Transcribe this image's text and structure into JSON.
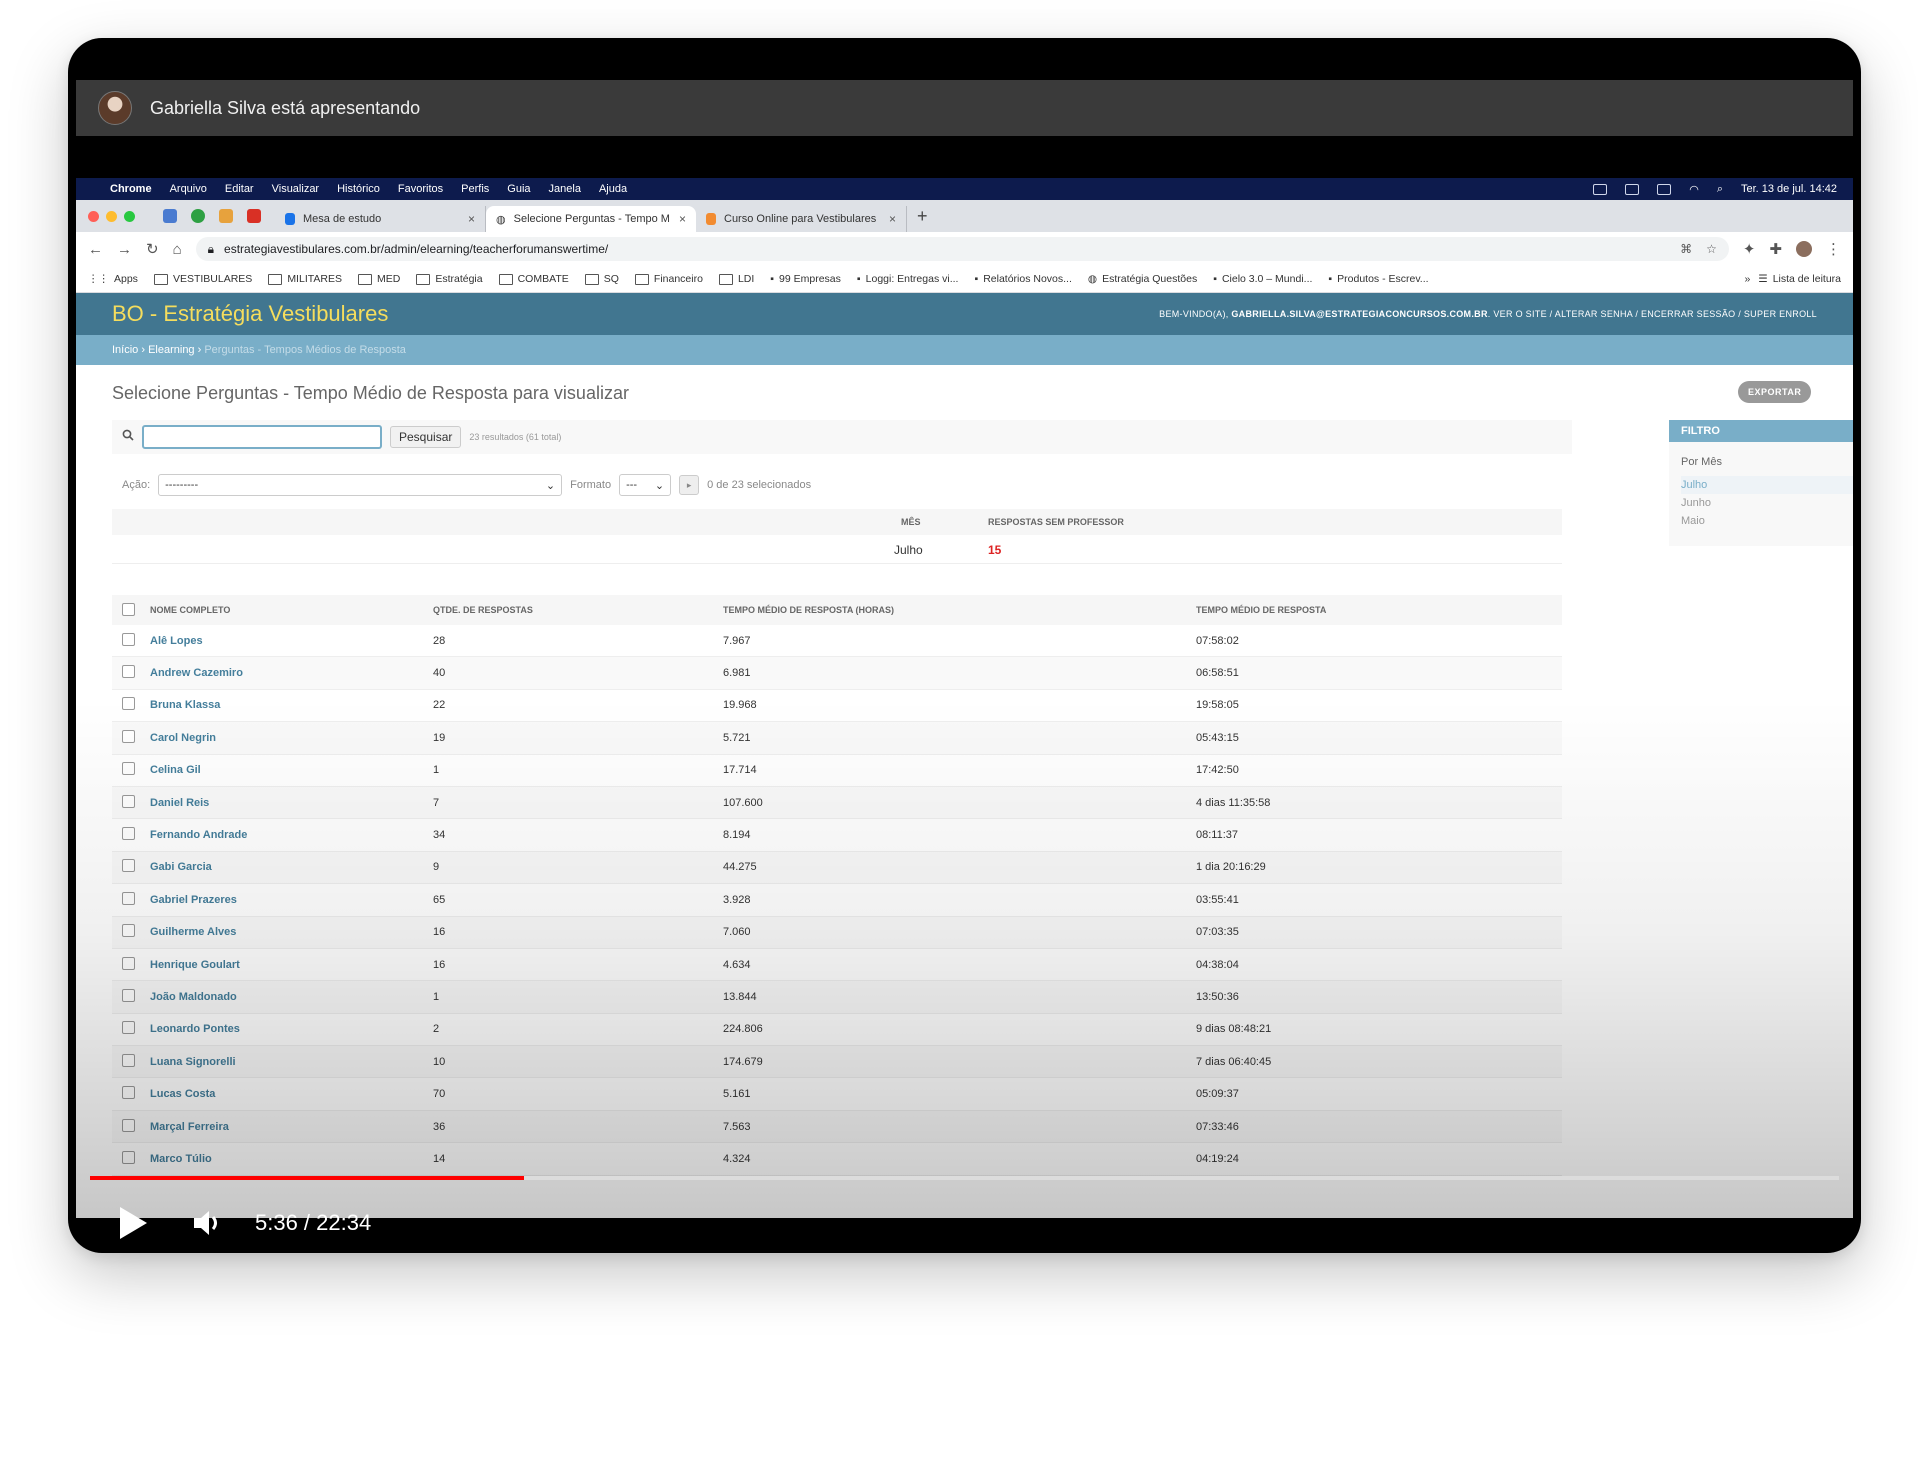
{
  "video": {
    "presenter_text": "Gabriella Silva está apresentando",
    "time_display": "5:36 / 22:34",
    "progress_fraction": 0.248
  },
  "macos": {
    "menu": [
      "Chrome",
      "Arquivo",
      "Editar",
      "Visualizar",
      "Histórico",
      "Favoritos",
      "Perfis",
      "Guia",
      "Janela",
      "Ajuda"
    ],
    "clock": "Ter. 13 de jul. 14:42"
  },
  "browser": {
    "tabs": [
      {
        "title": "Mesa de estudo"
      },
      {
        "title": "Selecione Perguntas - Tempo M"
      },
      {
        "title": "Curso Online para Vestibulares"
      }
    ],
    "url": "estrategiavestibulares.com.br/admin/elearning/teacherforumanswertime/",
    "bookmarks": [
      "Apps",
      "VESTIBULARES",
      "MILITARES",
      "MED",
      "Estratégia",
      "COMBATE",
      "SQ",
      "Financeiro",
      "LDI",
      "99 Empresas",
      "Loggi: Entregas vi...",
      "Relatórios Novos...",
      "Estratégia Questões",
      "Cielo 3.0 – Mundi...",
      "Produtos - Escrev..."
    ],
    "reading_list": "Lista de leitura"
  },
  "admin": {
    "site_title": "BO - Estratégia Vestibulares",
    "welcome": "BEM-VINDO(A),",
    "user_email": "GABRIELLA.SILVA@ESTRATEGIACONCURSOS.COM.BR",
    "user_links": "VER O SITE / ALTERAR SENHA / ENCERRAR SESSÃO / SUPER ENROLL",
    "breadcrumb": {
      "home": "Início",
      "app": "Elearning",
      "current": "Perguntas - Tempos Médios de Resposta"
    },
    "page_heading": "Selecione Perguntas - Tempo Médio de Resposta para visualizar",
    "export_label": "EXPORTAR",
    "search_button": "Pesquisar",
    "result_count": "23 resultados (61 total)",
    "action_label": "Ação:",
    "action_value": "---------",
    "format_label": "Formato",
    "format_value": "---",
    "selected_count": "0 de 23 selecionados",
    "summary": {
      "col_month": "MÊS",
      "col_unanswered": "RESPOSTAS SEM PROFESSOR",
      "month": "Julho",
      "unanswered": "15"
    },
    "table": {
      "headers": [
        "NOME COMPLETO",
        "QTDE. DE RESPOSTAS",
        "TEMPO MÉDIO DE RESPOSTA (HORAS)",
        "TEMPO MÉDIO DE RESPOSTA"
      ],
      "rows": [
        [
          "Alê Lopes",
          "28",
          "7.967",
          "07:58:02"
        ],
        [
          "Andrew Cazemiro",
          "40",
          "6.981",
          "06:58:51"
        ],
        [
          "Bruna Klassa",
          "22",
          "19.968",
          "19:58:05"
        ],
        [
          "Carol Negrin",
          "19",
          "5.721",
          "05:43:15"
        ],
        [
          "Celina Gil",
          "1",
          "17.714",
          "17:42:50"
        ],
        [
          "Daniel Reis",
          "7",
          "107.600",
          "4 dias 11:35:58"
        ],
        [
          "Fernando Andrade",
          "34",
          "8.194",
          "08:11:37"
        ],
        [
          "Gabi Garcia",
          "9",
          "44.275",
          "1 dia 20:16:29"
        ],
        [
          "Gabriel Prazeres",
          "65",
          "3.928",
          "03:55:41"
        ],
        [
          "Guilherme Alves",
          "16",
          "7.060",
          "07:03:35"
        ],
        [
          "Henrique Goulart",
          "16",
          "4.634",
          "04:38:04"
        ],
        [
          "João Maldonado",
          "1",
          "13.844",
          "13:50:36"
        ],
        [
          "Leonardo Pontes",
          "2",
          "224.806",
          "9 dias 08:48:21"
        ],
        [
          "Luana Signorelli",
          "10",
          "174.679",
          "7 dias 06:40:45"
        ],
        [
          "Lucas Costa",
          "70",
          "5.161",
          "05:09:37"
        ],
        [
          "Marçal Ferreira",
          "36",
          "7.563",
          "07:33:46"
        ],
        [
          "Marco Túlio",
          "14",
          "4.324",
          "04:19:24"
        ]
      ]
    },
    "filter": {
      "title": "FILTRO",
      "by_month": "Por Mês",
      "options": [
        "Julho",
        "Junho",
        "Maio"
      ],
      "selected": "Julho"
    }
  },
  "colors": {
    "header_bg": "#417690",
    "title": "#f5dd5d",
    "breadcrumb_bg": "#79aec8",
    "progress": "#ff0000"
  }
}
